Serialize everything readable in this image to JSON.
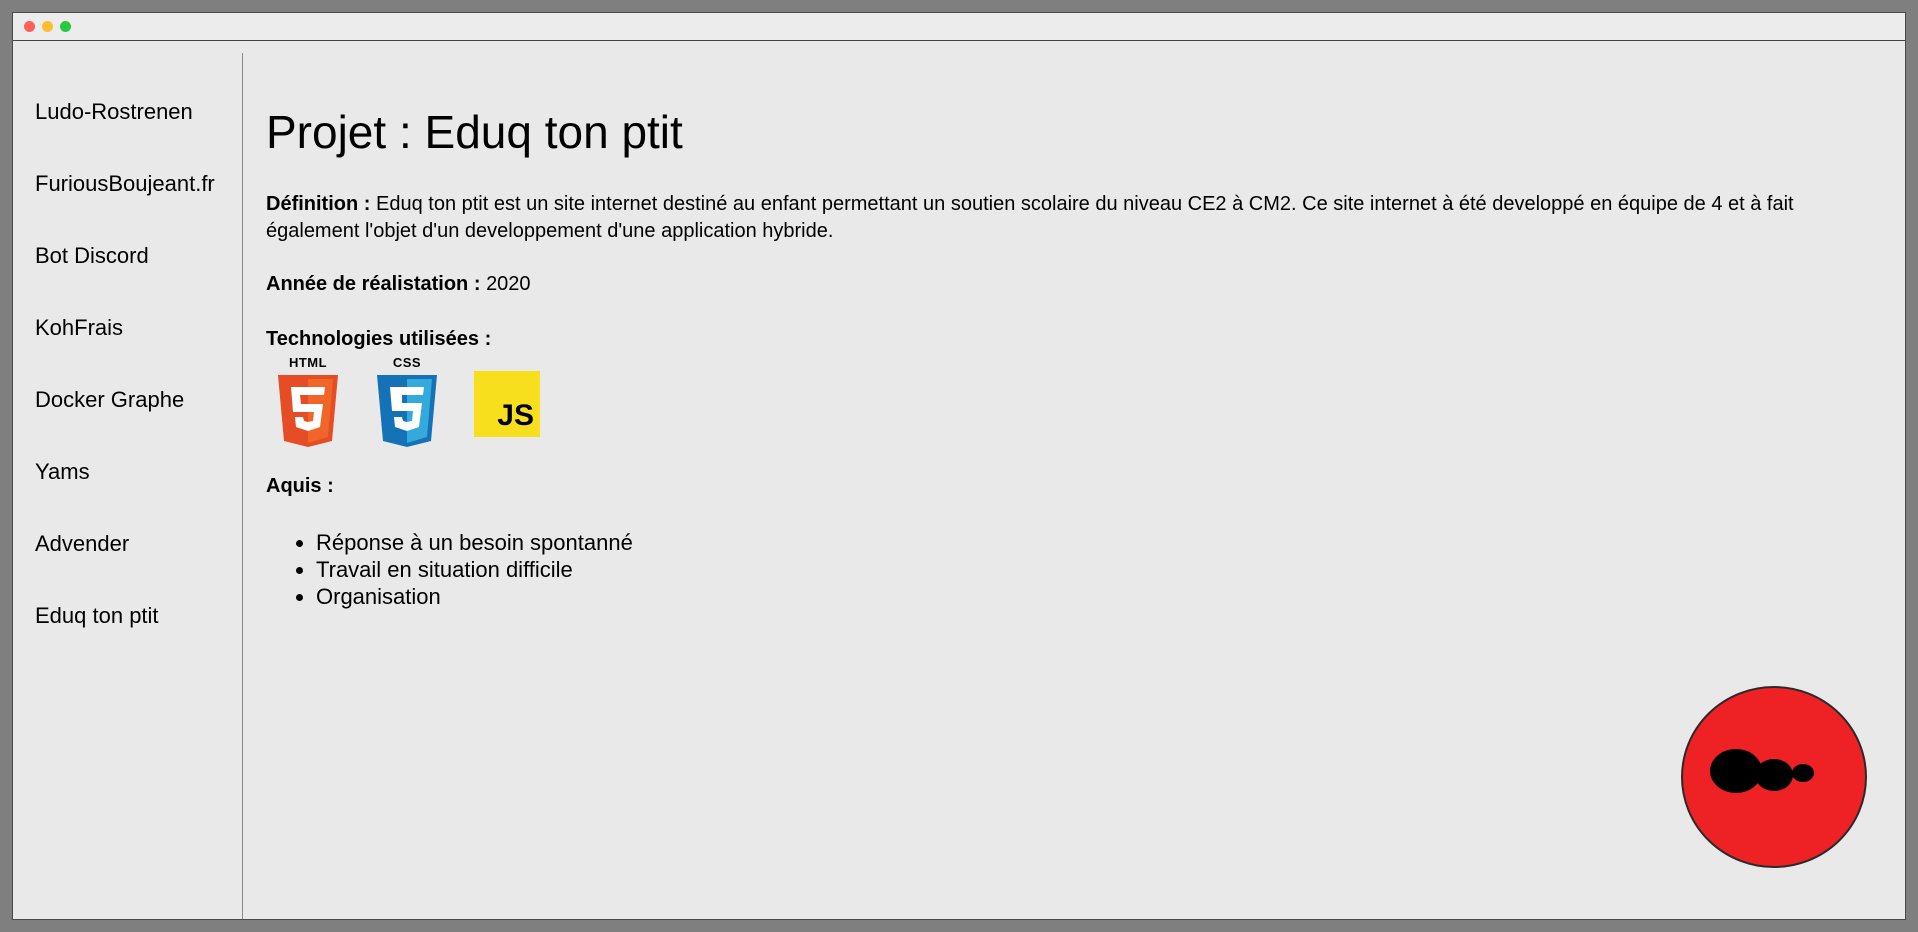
{
  "window": {
    "controls": [
      "close",
      "minimize",
      "maximize"
    ],
    "colors": {
      "close": "#ff5f56",
      "minimize": "#ffbd2e",
      "maximize": "#27c93f"
    }
  },
  "sidebar": {
    "items": [
      {
        "label": "Ludo-Rostrenen"
      },
      {
        "label": "FuriousBoujeant.fr"
      },
      {
        "label": "Bot Discord"
      },
      {
        "label": "KohFrais"
      },
      {
        "label": "Docker Graphe"
      },
      {
        "label": "Yams"
      },
      {
        "label": "Advender"
      },
      {
        "label": "Eduq ton ptit"
      }
    ]
  },
  "project": {
    "title": "Projet : Eduq ton ptit",
    "definition_label": "Définition :",
    "definition_text": "Eduq ton ptit est un site internet destiné au enfant permettant un soutien scolaire du niveau CE2 à CM2. Ce site internet à été developpé en équipe de 4 et à fait également l'objet d'un developpement d'une application hybride.",
    "year_label": "Année de réalistation :",
    "year_value": "2020",
    "tech_label": "Technologies utilisées :",
    "technologies": [
      {
        "name": "HTML",
        "icon": "html5-icon",
        "color": "#e44d26"
      },
      {
        "name": "CSS",
        "icon": "css3-icon",
        "color": "#1572b6"
      },
      {
        "name": "JS",
        "icon": "javascript-icon",
        "color": "#f7df1e"
      }
    ],
    "acquis_label": "Aquis :",
    "acquis": [
      "Réponse à un besoin spontanné",
      "Travail en situation difficile",
      "Organisation"
    ]
  },
  "fab": {
    "icon": "red-circle-logo-icon",
    "color": "#ee2125"
  }
}
